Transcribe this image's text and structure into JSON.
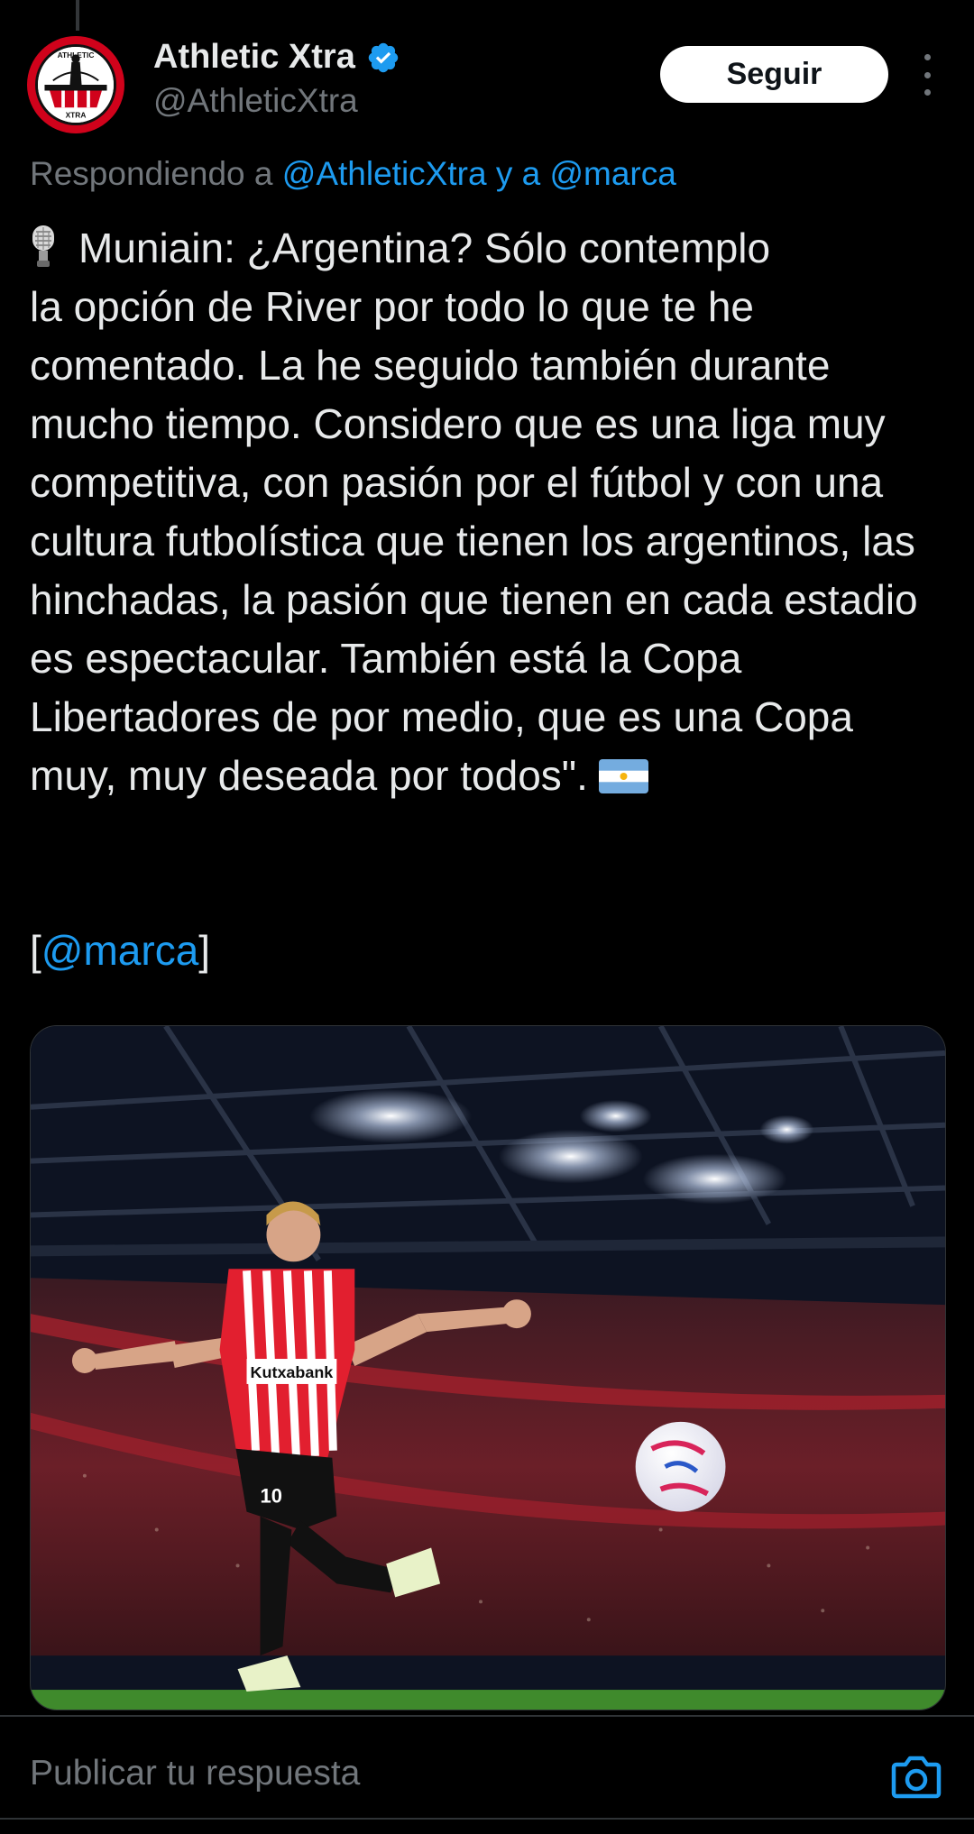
{
  "account": {
    "display_name": "Athletic Xtra",
    "handle": "@AthleticXtra",
    "avatar_text_top": "ATHLETIC",
    "avatar_text_bottom": "XTRA",
    "follow_label": "Seguir"
  },
  "replying": {
    "prefix": "Respondiendo a ",
    "mention_1": "@AthleticXtra",
    "joiner": " y a ",
    "mention_2": "@marca"
  },
  "tweet": {
    "text": "Muniain: ¿Argentina? Sólo contemplo\nla opción de River por todo lo que te he comentado. La he seguido también durante mucho tiempo. Considero que es una liga muy competitiva, con pasión por el fútbol y con una cultura futbolística que tienen los argentinos, las hinchadas, la pasión que tienen en cada estadio es espectacular. También está la Copa Libertadores de por medio, que es una Copa muy, muy deseada por todos\".",
    "source_open": "[",
    "source_mention": "@marca",
    "source_close": "]"
  },
  "media": {
    "shirt_sponsor": "Kutxabank",
    "shirt_number": "10"
  },
  "reply": {
    "placeholder": "Publicar tu respuesta"
  },
  "colors": {
    "background": "#000000",
    "text": "#e7e9ea",
    "muted": "#71767b",
    "accent": "#1d9bf0",
    "follow_bg": "#ffffff"
  },
  "icons": [
    "verified-icon",
    "more-icon",
    "microphone-icon",
    "argentina-flag-icon",
    "camera-icon"
  ]
}
